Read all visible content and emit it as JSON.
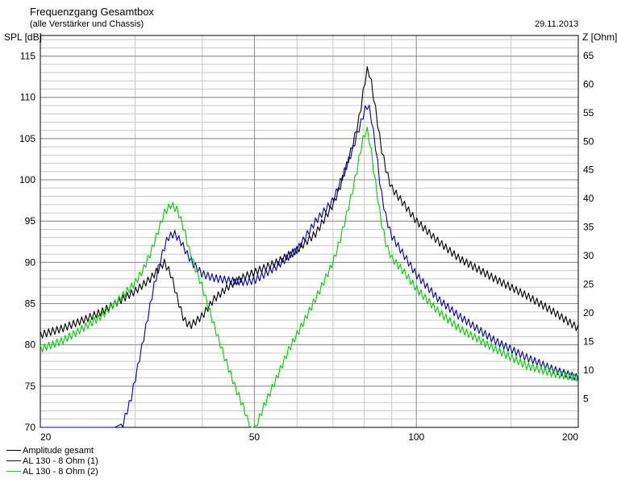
{
  "header": {
    "title": "Frequenzgang Gesamtbox",
    "subtitle": "(alle Verstärker und Chassis)",
    "date": "29.11.2013"
  },
  "chart_data": {
    "type": "line",
    "title": "Frequenzgang Gesamtbox",
    "subtitle": "(alle Verstärker und Chassis)",
    "x_scale": "log",
    "xlim": [
      20,
      200
    ],
    "x_ticks": [
      20,
      50,
      100,
      200
    ],
    "ylabel": "SPL [dB]",
    "ylim": [
      70,
      117.5
    ],
    "y_ticks": [
      70,
      75,
      80,
      85,
      90,
      95,
      100,
      105,
      110,
      115
    ],
    "y2label": "Z [Ohm]",
    "y2lim": [
      0,
      68.5
    ],
    "y2_ticks": [
      5,
      10,
      15,
      20,
      25,
      30,
      35,
      40,
      45,
      50,
      55,
      60,
      65
    ],
    "grid": true,
    "legend_position": "bottom-left",
    "series": [
      {
        "name": "Amplitude gesamt",
        "color": "#000000",
        "x": [
          20,
          22,
          24,
          26,
          28,
          30,
          32,
          33,
          34,
          35,
          36,
          37,
          38,
          40,
          42,
          45,
          48,
          50,
          55,
          60,
          65,
          70,
          72,
          74,
          76,
          78,
          79,
          80,
          81,
          82,
          84,
          86,
          88,
          90,
          95,
          100,
          110,
          120,
          140,
          160,
          180,
          200
        ],
        "y": [
          81.2,
          82,
          83,
          84,
          85.3,
          86.5,
          88,
          89,
          90,
          88.5,
          85.5,
          83,
          82.3,
          83.5,
          85.5,
          87.2,
          88.3,
          88.8,
          90,
          91.5,
          93.5,
          97,
          99,
          101.5,
          104,
          107,
          109,
          111.5,
          113.3,
          112.8,
          108.5,
          104,
          101,
          99,
          97,
          95,
          92.5,
          90.5,
          88,
          86,
          84,
          82
        ]
      },
      {
        "name": "AL 130 - 8 Ohm (1)",
        "color": "#0000a0",
        "x": [
          20,
          27.5,
          28.5,
          29.5,
          30.5,
          31.5,
          32.5,
          33.5,
          34.5,
          35.5,
          36.5,
          37.5,
          38.5,
          40,
          42,
          45,
          48,
          50,
          55,
          60,
          65,
          70,
          72,
          74,
          76,
          78,
          79,
          80,
          81,
          82,
          84,
          86,
          88,
          90,
          95,
          100,
          110,
          120,
          140,
          160,
          180,
          200
        ],
        "y": [
          70,
          70,
          70.5,
          73.5,
          78,
          82.5,
          87,
          90.5,
          93,
          93.5,
          92.5,
          91,
          89.8,
          88.6,
          88.1,
          87.8,
          87.6,
          87.8,
          89.5,
          91.5,
          95,
          97.5,
          99.5,
          101.5,
          103.5,
          106,
          107,
          108.3,
          109,
          108.5,
          104,
          98.5,
          95.2,
          93.2,
          90.8,
          88.5,
          85.5,
          83.5,
          80.5,
          78.5,
          77,
          76
        ]
      },
      {
        "name": "AL 130 - 8 Ohm (2)",
        "color": "#00cc00",
        "x": [
          20,
          22,
          24,
          26,
          28,
          30,
          31,
          32,
          33,
          34,
          35,
          36,
          37,
          38,
          40,
          42,
          44,
          46,
          48,
          49,
          50,
          51,
          52,
          55,
          58,
          62,
          66,
          70,
          72,
          74,
          76,
          78,
          79,
          80,
          81,
          82,
          84,
          86,
          88,
          90,
          95,
          100,
          110,
          120,
          140,
          160,
          180,
          200
        ],
        "y": [
          79.5,
          80.5,
          82,
          83.5,
          85.5,
          87.5,
          89,
          91,
          93.5,
          96,
          97,
          96.3,
          94,
          91,
          87,
          82.5,
          78.5,
          75,
          72,
          70,
          70,
          71,
          72.5,
          76,
          79.5,
          83,
          86.5,
          90,
          92.5,
          95.5,
          98.5,
          102,
          104,
          105.5,
          106,
          104.5,
          99.5,
          95,
          92,
          90.5,
          88.8,
          86.8,
          84,
          82,
          79.5,
          77.5,
          76.5,
          76
        ]
      }
    ]
  }
}
